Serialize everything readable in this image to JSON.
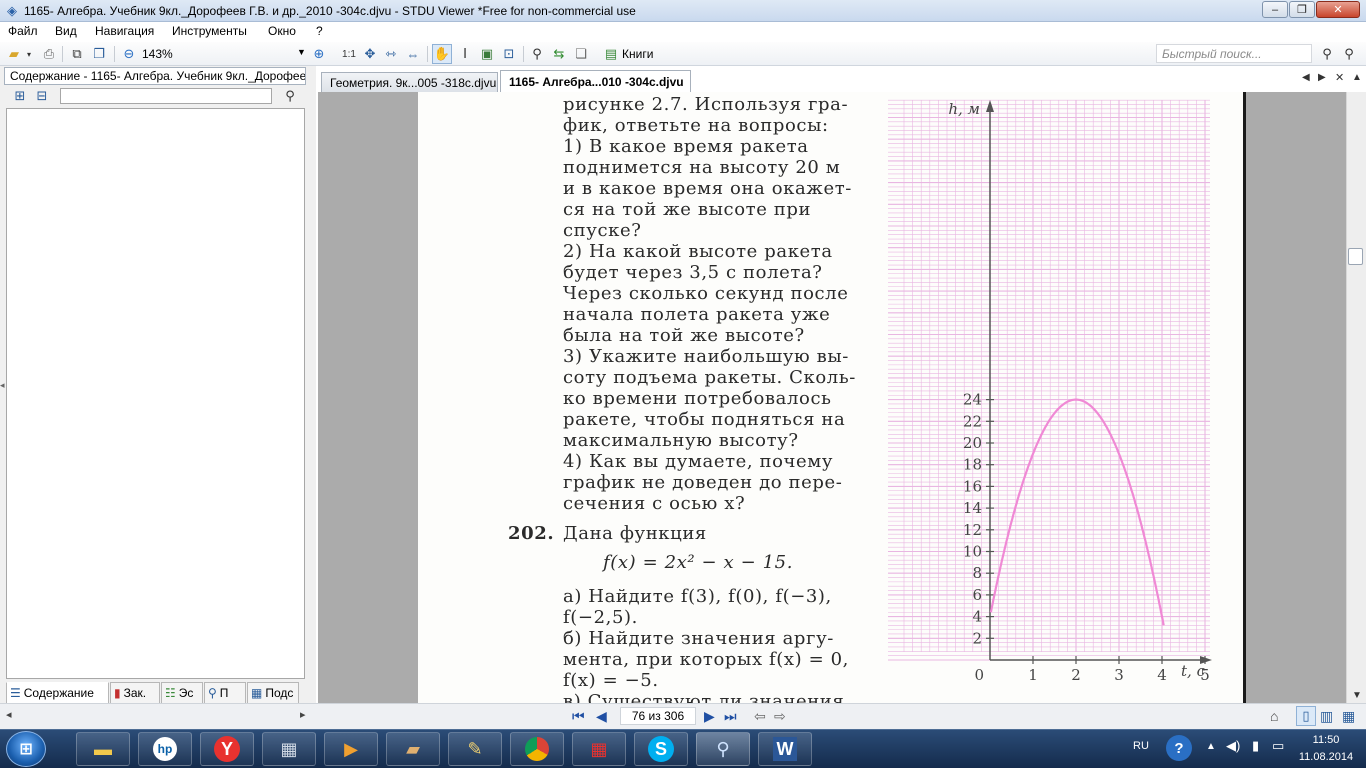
{
  "window": {
    "title": "1165- Алгебра. Учебник 9кл._Дорофеев Г.В. и др._2010 -304c.djvu - STDU Viewer *Free for non-commercial use",
    "minimize": "–",
    "maximize": "❐",
    "close": "✕"
  },
  "menu": [
    "Файл",
    "Вид",
    "Навигация",
    "Инструменты",
    "Окно",
    "?"
  ],
  "toolbar": {
    "zoom": "143%",
    "one_to_one": "1:1",
    "books": "Книги",
    "search_placeholder": "Быстрый поиск..."
  },
  "left_panel": {
    "tab_title": "Содержание - 1165- Алгебра. Учебник 9кл._Дорофеев",
    "bottom_tabs": [
      "Содержание",
      "Зак.",
      "Эс",
      "П",
      "Подс"
    ]
  },
  "doc_tabs": [
    "Геометрия. 9к...005 -318c.djvu",
    "1165- Алгебра...010 -304c.djvu"
  ],
  "page_text": {
    "lines_q201": [
      "рисунке 2.7. Используя гра-",
      "фик, ответьте на вопросы:",
      "1) В какое время ракета",
      "поднимется на высоту 20 м",
      "и в какое время она окажет-",
      "ся на той же высоте при",
      "спуске?",
      "2) На какой высоте ракета",
      "будет через 3,5 с полета?",
      "Через сколько секунд после",
      "начала полета ракета уже",
      "была на той же высоте?",
      "3) Укажите наибольшую вы-",
      "соту подъема ракеты. Сколь-",
      "ко времени потребовалось",
      "ракете, чтобы подняться на",
      "максимальную высоту?",
      "4) Как вы думаете, почему",
      "график не доведен до пере-",
      "сечения с осью x?"
    ],
    "problem_number": "202.",
    "problem_head": "Дана функция",
    "formula": "f(x) = 2x² − x − 15.",
    "lines_q202": [
      "а) Найдите f(3), f(0), f(−3),",
      "f(−2,5).",
      "б) Найдите значения аргу-",
      "мента, при которых f(x) = 0,",
      "f(x) = −5.",
      "в) Существуют ли значения"
    ]
  },
  "figure": {
    "y_axis_label": "h, м",
    "x_axis_label": "t, c",
    "origin_label": "0",
    "y_ticks": [
      "2",
      "4",
      "6",
      "8",
      "10",
      "12",
      "14",
      "16",
      "18",
      "20",
      "22",
      "24"
    ],
    "x_ticks": [
      "1",
      "2",
      "3",
      "4",
      "5"
    ],
    "curve_color": "#f089d5",
    "grid_color": "#e9b6e2"
  },
  "status": {
    "page_counter": "76 из 306"
  },
  "taskbar": {
    "lang": "RU",
    "time": "11:50",
    "date": "11.08.2014"
  }
}
